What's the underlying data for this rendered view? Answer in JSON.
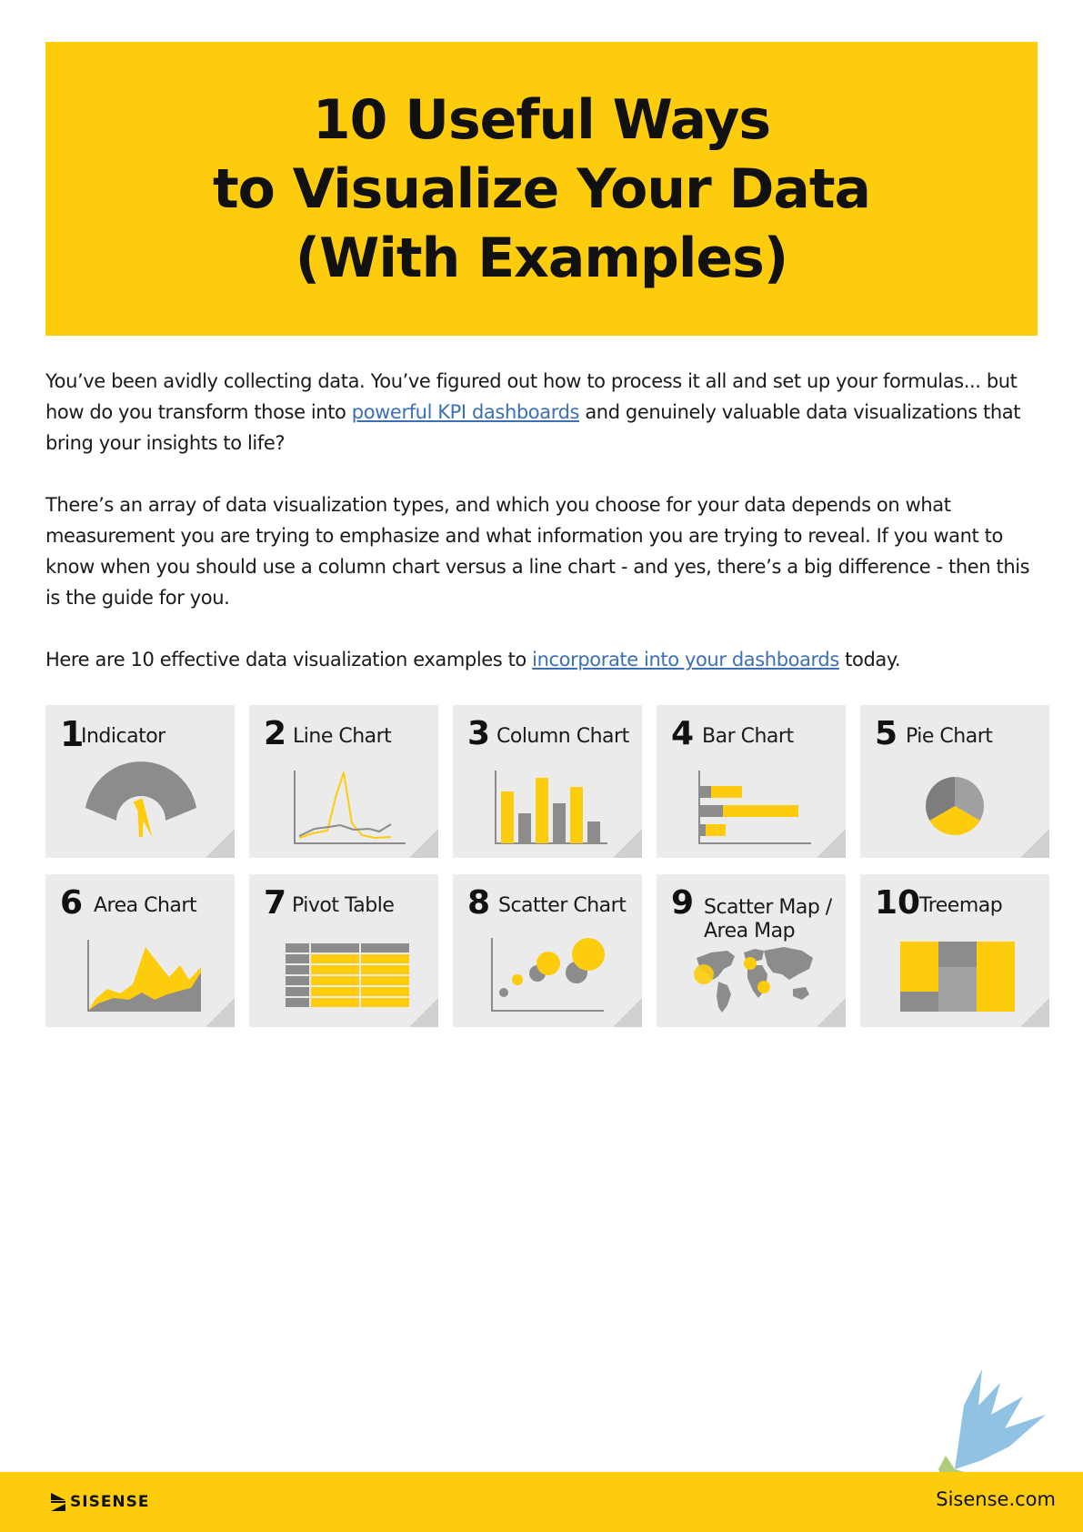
{
  "title": {
    "line1": "10 Useful Ways",
    "line2": "to Visualize Your Data",
    "line3": "(With Examples)"
  },
  "intro": {
    "p1_a": "You’ve been avidly collecting data. You’ve figured out how to process it all and set up your formulas... but how do you transform those into ",
    "p1_link": "powerful KPI dashboards",
    "p1_b": " and genuinely valuable data visualizations that bring your insights to life?",
    "p2": "There’s an array of data visualization types, and which you choose for your data depends on what measurement you are trying to emphasize and what information you are trying to reveal. If you want to know when you should use a column chart versus a line chart - and yes, there’s a big difference - then this is the guide for you.",
    "p3_a": "Here are 10 effective data visualization examples to ",
    "p3_link": "incorporate into your dashboards",
    "p3_b": " today."
  },
  "cards": [
    {
      "num": "1",
      "label": "Indicator",
      "icon": "gauge-icon"
    },
    {
      "num": "2",
      "label": "Line Chart",
      "icon": "line-chart-icon"
    },
    {
      "num": "3",
      "label": "Column Chart",
      "icon": "column-chart-icon"
    },
    {
      "num": "4",
      "label": "Bar Chart",
      "icon": "bar-chart-icon"
    },
    {
      "num": "5",
      "label": "Pie Chart",
      "icon": "pie-chart-icon"
    },
    {
      "num": "6",
      "label": "Area Chart",
      "icon": "area-chart-icon"
    },
    {
      "num": "7",
      "label": "Pivot Table",
      "icon": "pivot-table-icon"
    },
    {
      "num": "8",
      "label": "Scatter Chart",
      "icon": "scatter-chart-icon"
    },
    {
      "num": "9",
      "label": "Scatter Map /",
      "label2": "Area Map",
      "icon": "world-map-icon"
    },
    {
      "num": "10",
      "label": "Treemap",
      "icon": "treemap-icon"
    }
  ],
  "footer": {
    "brand": "SISENSE",
    "url": "Sisense.com"
  },
  "colors": {
    "accent_yellow": "#fdcc0d",
    "card_bg": "#ebebeb",
    "icon_gray": "#8c8c8c",
    "link_blue": "#3b6fb6"
  }
}
